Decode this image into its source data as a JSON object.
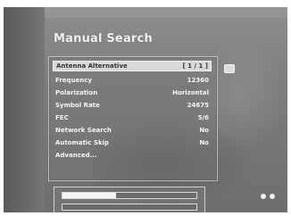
{
  "menu": {
    "title": "Manual Search",
    "items": [
      {
        "label": "Antenna Alternative",
        "value": "[ 1 / 1 ]",
        "selected": true
      },
      {
        "label": "Frequency",
        "value": "12360",
        "selected": false
      },
      {
        "label": "Polarization",
        "value": "Horizontal",
        "selected": false
      },
      {
        "label": "Symbol Rate",
        "value": "24675",
        "selected": false
      },
      {
        "label": "FEC",
        "value": "5/6",
        "selected": false
      },
      {
        "label": "Network Search",
        "value": "No",
        "selected": false
      },
      {
        "label": "Automatic Skip",
        "value": "No",
        "selected": false
      },
      {
        "label": "Advanced...",
        "value": "",
        "selected": false
      }
    ]
  },
  "signal": {
    "strength_fraction": 0.4,
    "quality_fraction": 0.0
  },
  "icons": {
    "selection_marker": "selection-indicator-icon",
    "remote": "remote-control-icon"
  },
  "colors": {
    "background": "#7f7f7f",
    "text": "#f5f5f5",
    "selected_row_bg": "#d9d9d9"
  }
}
